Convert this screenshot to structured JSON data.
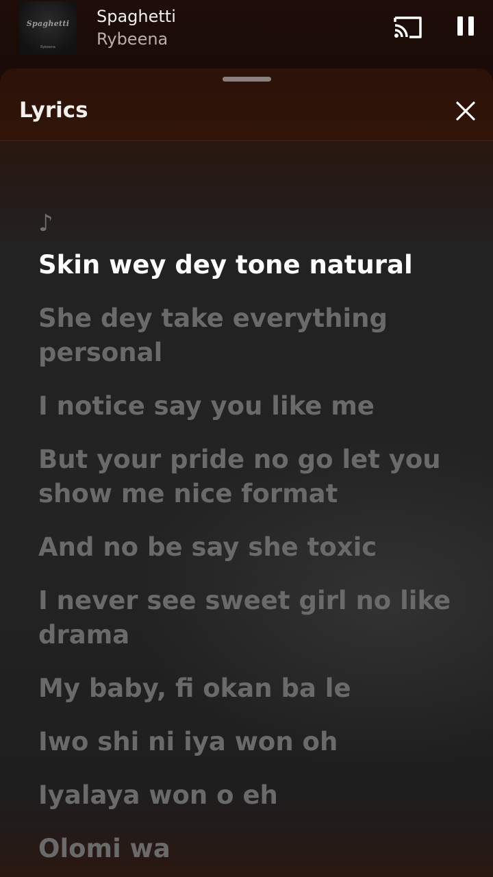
{
  "mini_player": {
    "album_art_title": "Spaghetti",
    "album_art_artist": "Rybeena",
    "track_title": "Spaghetti",
    "artist": "Rybeena",
    "cast_icon": "cast-icon",
    "pause_icon": "pause-icon"
  },
  "lyrics_sheet": {
    "title": "Lyrics",
    "close_icon": "close-icon",
    "music_note": "♪",
    "lines": [
      "Skin wey dey tone natural",
      "She dey take everything personal",
      "I notice say you like me",
      "But your pride no go let you show me nice format",
      "And no be say she toxic",
      "I never see sweet girl no like drama",
      "My baby, fi okan ba le",
      "Iwo shi ni iya won oh",
      "Iyalaya won o eh",
      "Olomi wa"
    ],
    "active_line_index": 0
  },
  "colors": {
    "active_lyric": "#ffffff",
    "inactive_lyric": "#6a6a6a",
    "header_bg": "#2c1209"
  }
}
